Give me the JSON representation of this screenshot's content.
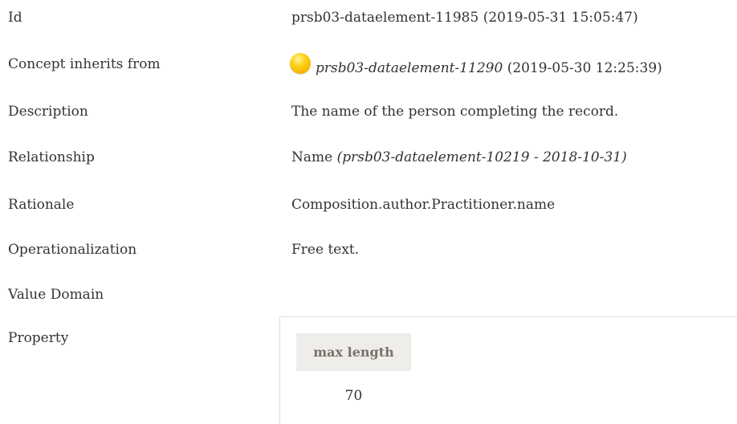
{
  "rows": {
    "id": {
      "label": "Id",
      "value": "prsb03-dataelement-11985 (2019-05-31 15:05:47)"
    },
    "concept_inherits_from": {
      "label": "Concept inherits from",
      "status_icon": "yellow-status-dot-icon",
      "link_text": "prsb03-dataelement-11290",
      "suffix": " (2019-05-30 12:25:39)"
    },
    "description": {
      "label": "Description",
      "value": "The name of the person completing the record."
    },
    "relationship": {
      "label": "Relationship",
      "prefix": "Name ",
      "italic_text": "(prsb03-dataelement-10219 - 2018-10-31)"
    },
    "rationale": {
      "label": "Rationale",
      "value": "Composition.author.Practitioner.name"
    },
    "operationalization": {
      "label": "Operationalization",
      "value": "Free text."
    },
    "value_domain": {
      "label": "Value Domain"
    },
    "property": {
      "label": "Property",
      "table_header": "max length",
      "table_value": "70"
    }
  },
  "colors": {
    "text": "#333333",
    "header_bg": "#efedea",
    "header_text": "#7a7168",
    "status_dot": "#ffd21a",
    "border": "#dddddd"
  }
}
